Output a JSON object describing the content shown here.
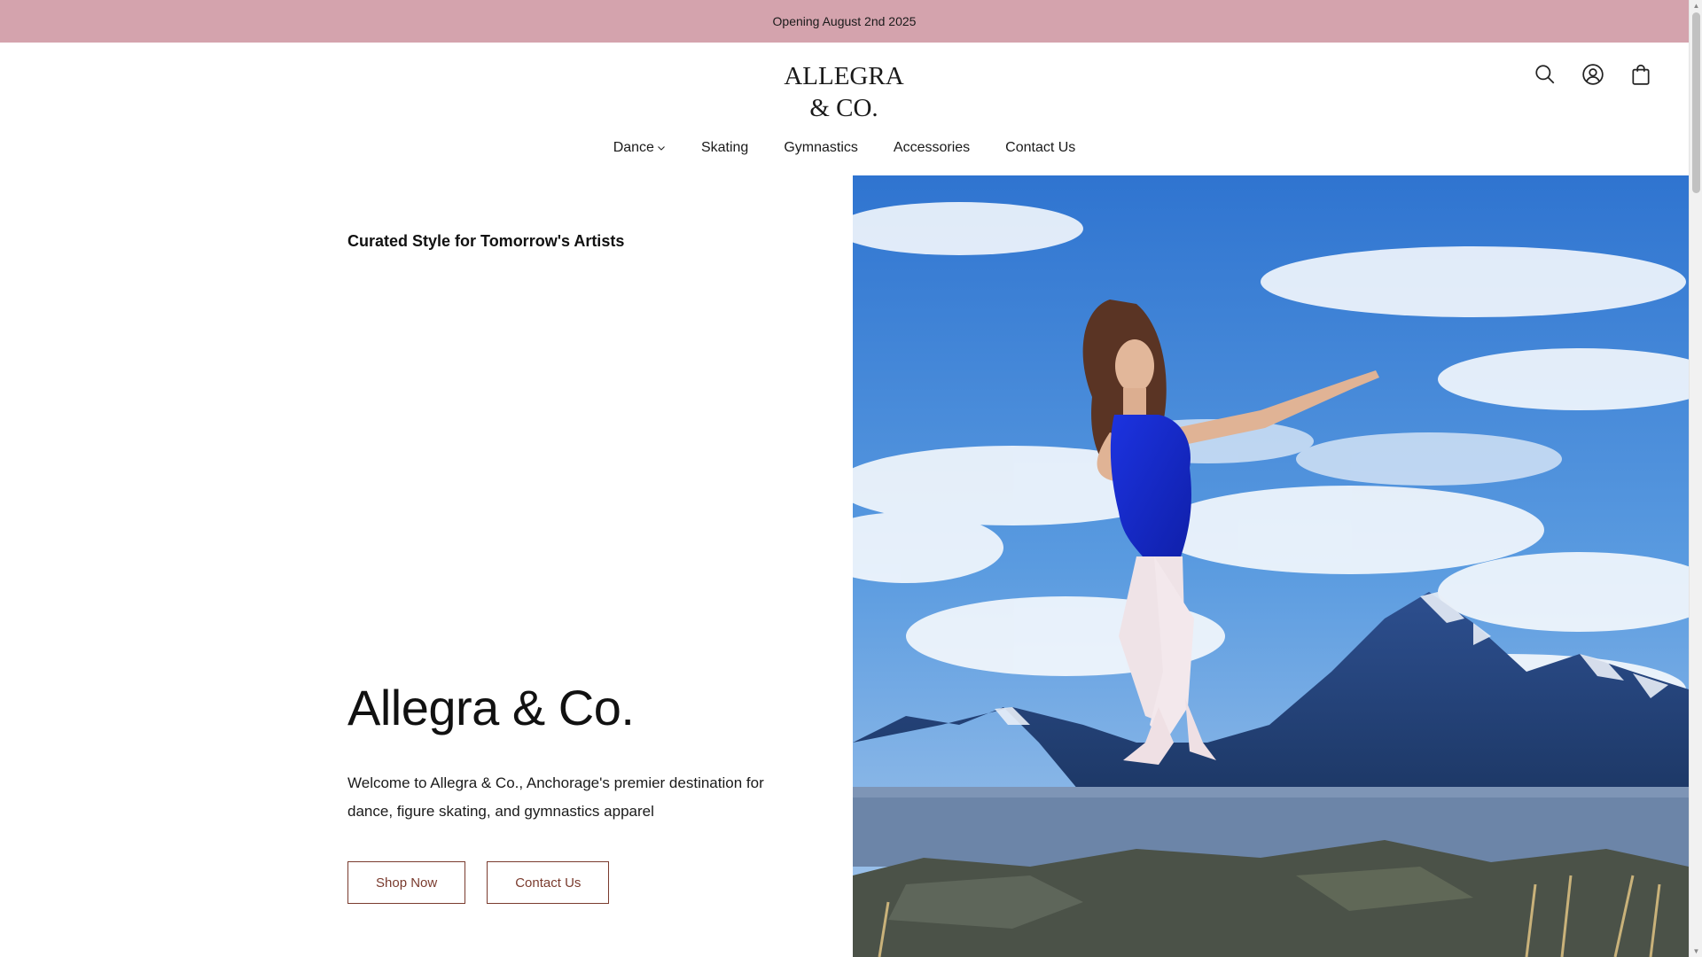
{
  "announcement": {
    "text": "Opening August 2nd 2025"
  },
  "header": {
    "logo_line1": "ALLEGRA",
    "logo_line2": "& CO.",
    "icons": [
      "search-icon",
      "account-icon",
      "cart-icon"
    ]
  },
  "nav": {
    "items": [
      {
        "label": "Dance",
        "has_dropdown": true
      },
      {
        "label": "Skating"
      },
      {
        "label": "Gymnastics"
      },
      {
        "label": "Accessories"
      },
      {
        "label": "Contact Us"
      }
    ]
  },
  "hero": {
    "tagline": "Curated Style for Tomorrow's Artists",
    "title": "Allegra & Co.",
    "description": "Welcome to Allegra & Co., Anchorage's premier destination for dance, figure skating, and gymnastics apparel",
    "buttons": {
      "primary": "Shop Now",
      "secondary": "Contact Us"
    }
  },
  "colors": {
    "announcement_bg": "#d4a3ad",
    "button_accent": "#7a3b2e",
    "leotard": "#1a2fd8",
    "sky": "#3d86d8"
  }
}
